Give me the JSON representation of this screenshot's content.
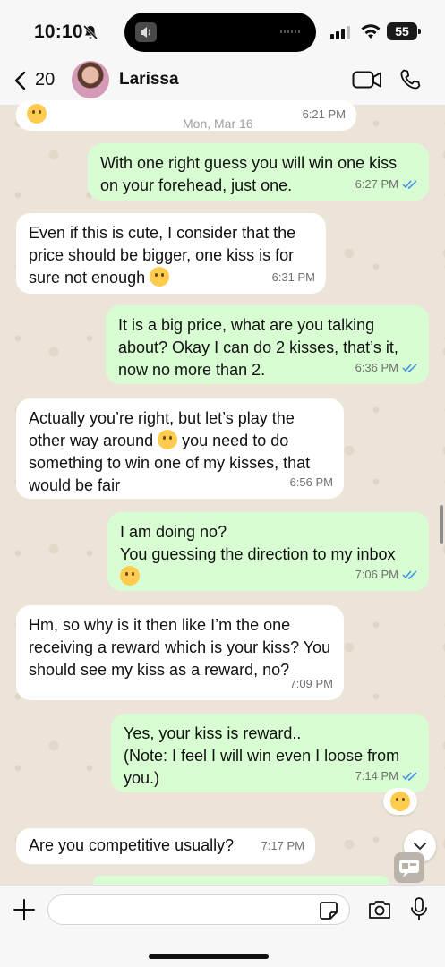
{
  "status": {
    "time": "10:10",
    "battery": "55"
  },
  "header": {
    "back_count": "20",
    "contact_name": "Larissa"
  },
  "date_separator": "Mon, Mar 16",
  "messages": [
    {
      "dir": "in",
      "text": "",
      "time": "6:21 PM"
    },
    {
      "dir": "out",
      "text": "With one right guess you will win one kiss on your forehead, just one.",
      "time": "6:27 PM"
    },
    {
      "dir": "in",
      "text": "Even if this is cute, I consider that the price should be bigger, one kiss is for sure not enough",
      "time": "6:31 PM"
    },
    {
      "dir": "out",
      "text": "It is a big price, what are you talking about? Okay I can do 2 kisses, that’s it, now no more than 2.",
      "time": "6:36 PM"
    },
    {
      "dir": "in",
      "text_a": "Actually you’re right, but let’s play the other way around",
      "text_b": "you need to do something to win one of my kisses, that would be fair",
      "time": "6:56 PM"
    },
    {
      "dir": "out",
      "line1": "I am doing no?",
      "line2": "You guessing the direction to my inbox",
      "time": "7:06 PM"
    },
    {
      "dir": "in",
      "text": "Hm, so why is it then like I’m the one receiving a reward which is your kiss? You should see my kiss as a reward, no?",
      "time": "7:09 PM"
    },
    {
      "dir": "out",
      "line1": "Yes, your kiss is reward..",
      "line2": "(Note: I feel I will win even I loose from you.)",
      "time": "7:14 PM"
    },
    {
      "dir": "in",
      "text": "Are you competitive usually?",
      "time": "7:17 PM"
    }
  ],
  "input": {
    "placeholder": ""
  },
  "colors": {
    "incoming": "#ffffff",
    "outgoing": "#d9fdd3",
    "tick_blue": "#3a8ee6"
  }
}
